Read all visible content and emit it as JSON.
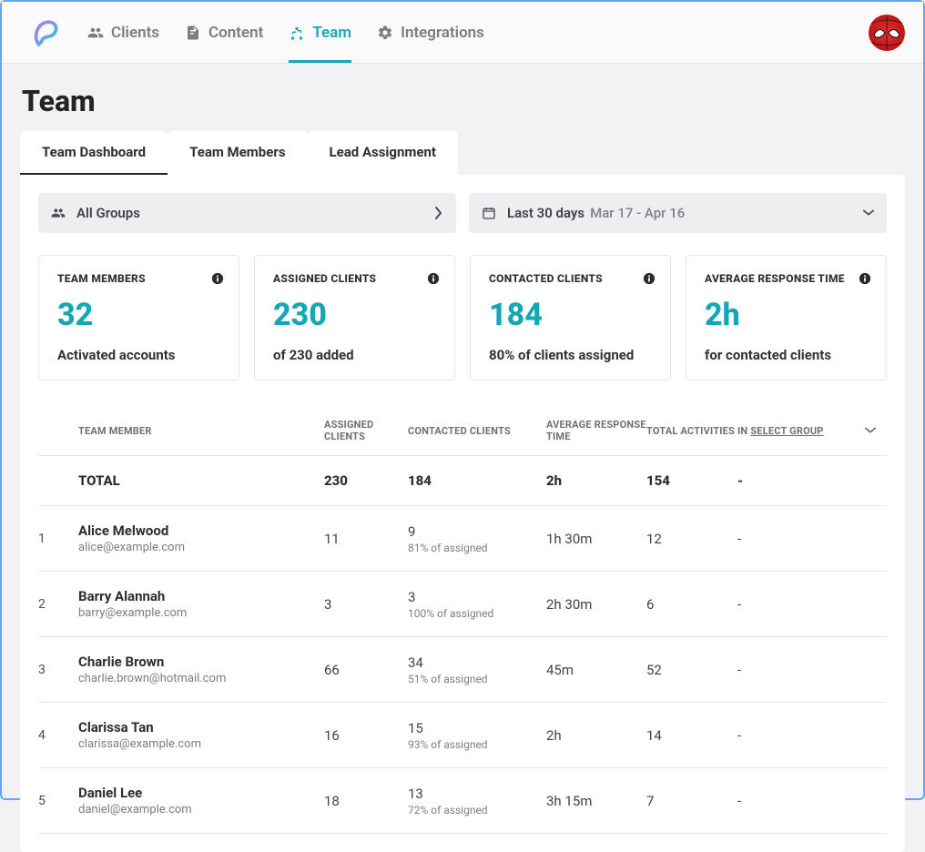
{
  "nav": {
    "clients": "Clients",
    "content": "Content",
    "team": "Team",
    "integrations": "Integrations"
  },
  "page_title": "Team",
  "tabs": {
    "dashboard": "Team Dashboard",
    "members": "Team Members",
    "lead": "Lead Assignment"
  },
  "filters": {
    "group_label": "All Groups",
    "date_label": "Last 30 days",
    "date_range": "Mar 17 - Apr 16"
  },
  "metrics": {
    "team_members": {
      "title": "TEAM MEMBERS",
      "value": "32",
      "sub": "Activated accounts"
    },
    "assigned": {
      "title": "ASSIGNED CLIENTS",
      "value": "230",
      "sub": "of 230 added"
    },
    "contacted": {
      "title": "CONTACTED CLIENTS",
      "value": "184",
      "sub": "80% of clients assigned"
    },
    "response": {
      "title": "AVERAGE RESPONSE TIME",
      "value": "2h",
      "sub": "for contacted clients"
    }
  },
  "table": {
    "headers": {
      "member": "TEAM MEMBER",
      "assigned": "ASSIGNED CLIENTS",
      "contacted": "CONTACTED CLIENTS",
      "response": "AVERAGE RESPONSE TIME",
      "activities": "TOTAL ACTIVITIES",
      "in": "IN",
      "group": "SELECT GROUP"
    },
    "total": {
      "label": "TOTAL",
      "assigned": "230",
      "contacted": "184",
      "response": "2h",
      "activities": "154",
      "group": "-"
    },
    "rows": [
      {
        "idx": "1",
        "name": "Alice Melwood",
        "email": "alice@example.com",
        "assigned": "11",
        "contacted": "9",
        "contacted_sub": "81% of assigned",
        "response": "1h 30m",
        "activities": "12",
        "group": "-"
      },
      {
        "idx": "2",
        "name": "Barry Alannah",
        "email": "barry@example.com",
        "assigned": "3",
        "contacted": "3",
        "contacted_sub": "100% of assigned",
        "response": "2h 30m",
        "activities": "6",
        "group": "-"
      },
      {
        "idx": "3",
        "name": "Charlie Brown",
        "email": "charlie.brown@hotmail.com",
        "assigned": "66",
        "contacted": "34",
        "contacted_sub": "51% of assigned",
        "response": "45m",
        "activities": "52",
        "group": "-"
      },
      {
        "idx": "4",
        "name": "Clarissa Tan",
        "email": "clarissa@example.com",
        "assigned": "16",
        "contacted": "15",
        "contacted_sub": "93% of assigned",
        "response": "2h",
        "activities": "14",
        "group": "-"
      },
      {
        "idx": "5",
        "name": "Daniel Lee",
        "email": "daniel@example.com",
        "assigned": "18",
        "contacted": "13",
        "contacted_sub": "72% of assigned",
        "response": "3h 15m",
        "activities": "7",
        "group": "-"
      }
    ]
  },
  "colors": {
    "accent": "#16a6b6"
  }
}
